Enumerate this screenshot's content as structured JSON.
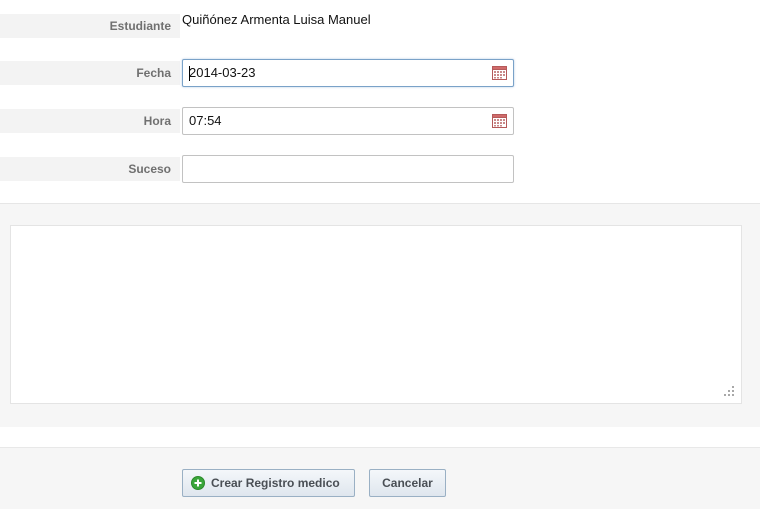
{
  "form": {
    "estudiante": {
      "label": "Estudiante",
      "value": "Quiñónez Armenta Luisa Manuel"
    },
    "fecha": {
      "label": "Fecha",
      "value": "2014-03-23",
      "icon": "calendar-icon"
    },
    "hora": {
      "label": "Hora",
      "value": "07:54",
      "icon": "calendar-icon"
    },
    "suceso": {
      "label": "Suceso",
      "value": ""
    }
  },
  "editor": {
    "content": ""
  },
  "actions": {
    "create_label": "Crear Registro medico",
    "create_icon": "add-circle-icon",
    "cancel_label": "Cancelar"
  },
  "colors": {
    "label_text": "#707070",
    "label_bg": "#f3f3f3",
    "focus_border": "#7aa2c8",
    "button_border": "#9ab0c4",
    "add_icon": "#3aa63a"
  }
}
